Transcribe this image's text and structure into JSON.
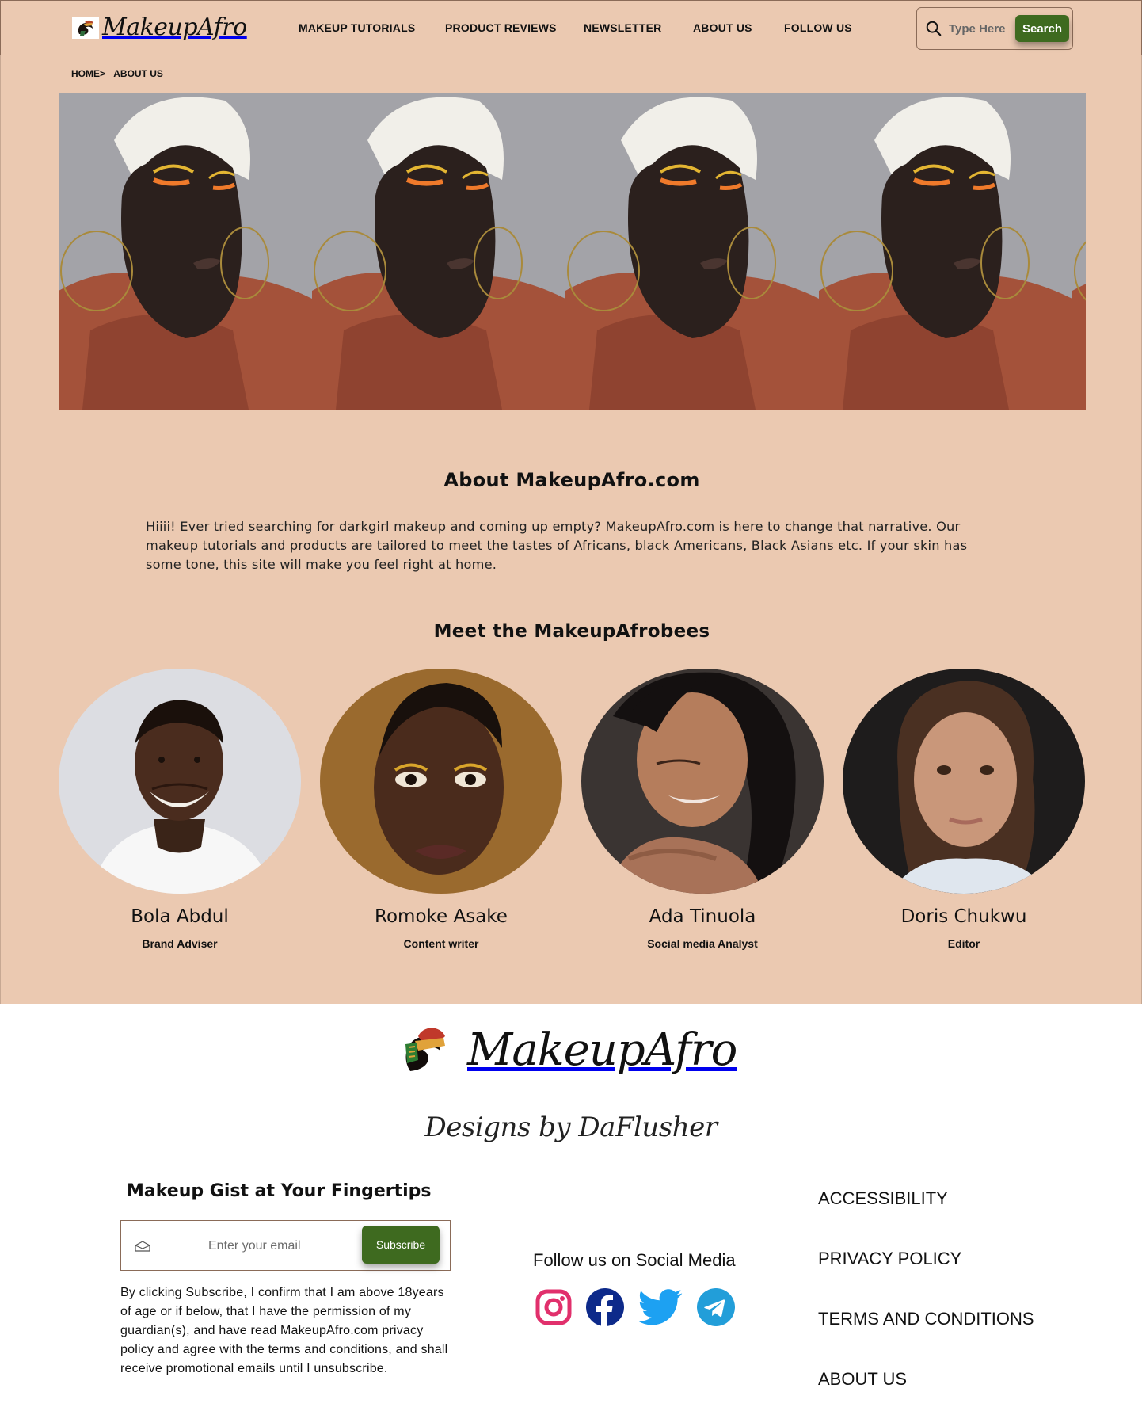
{
  "header": {
    "logo_text": "MakeupAfro",
    "nav": [
      {
        "label": "MAKEUP TUTORIALS"
      },
      {
        "label": "PRODUCT REVIEWS"
      },
      {
        "label": "NEWSLETTER"
      },
      {
        "label": "ABOUT US"
      },
      {
        "label": "FOLLOW US"
      }
    ],
    "search": {
      "placeholder": "Type Here",
      "button_label": "Search",
      "icon": "search-icon"
    }
  },
  "breadcrumb": {
    "home": "HOME>",
    "current": "ABOUT US"
  },
  "banner": {
    "panel_count": 5
  },
  "about": {
    "title": "About MakeupAfro.com",
    "body": "Hiiii! Ever tried searching for darkgirl makeup and coming up empty? MakeupAfro.com is here to change that narrative. Our makeup tutorials and products are tailored to meet the tastes of Africans, black Americans, Black Asians etc. If your skin has some tone, this site will make you feel right at home."
  },
  "team": {
    "title": "Meet the MakeupAfrobees",
    "members": [
      {
        "name": "Bola Abdul",
        "role": "Brand Adviser"
      },
      {
        "name": "Romoke Asake",
        "role": "Content writer"
      },
      {
        "name": "Ada Tinuola",
        "role": "Social media Analyst"
      },
      {
        "name": "Doris Chukwu",
        "role": "Editor"
      }
    ]
  },
  "footer": {
    "logo_text": "MakeupAfro",
    "credit": "Designs by DaFlusher",
    "newsletter": {
      "title": "Makeup Gist at Your Fingertips",
      "placeholder": "Enter your email",
      "button_label": "Subscribe",
      "icon": "envelope-icon",
      "disclaimer": "By clicking Subscribe, I confirm that I am above 18years of age or if below, that I have the permission of my guardian(s), and have read MakeupAfro.com privacy policy and agree with the terms and conditions, and shall receive promotional emails until I unsubscribe."
    },
    "social": {
      "title": "Follow us on Social Media",
      "icons": [
        "instagram-icon",
        "facebook-icon",
        "twitter-icon",
        "telegram-icon"
      ]
    },
    "links": [
      {
        "label": "ACCESSIBILITY"
      },
      {
        "label": "PRIVACY POLICY"
      },
      {
        "label": "TERMS AND CONDITIONS"
      },
      {
        "label": "ABOUT US"
      }
    ]
  },
  "colors": {
    "page_background": "#ebc9b1",
    "accent_green": "#3e6a1f",
    "instagram": "#e1306c",
    "facebook": "#1877f2",
    "twitter": "#1da1f2",
    "telegram": "#229ed9"
  }
}
